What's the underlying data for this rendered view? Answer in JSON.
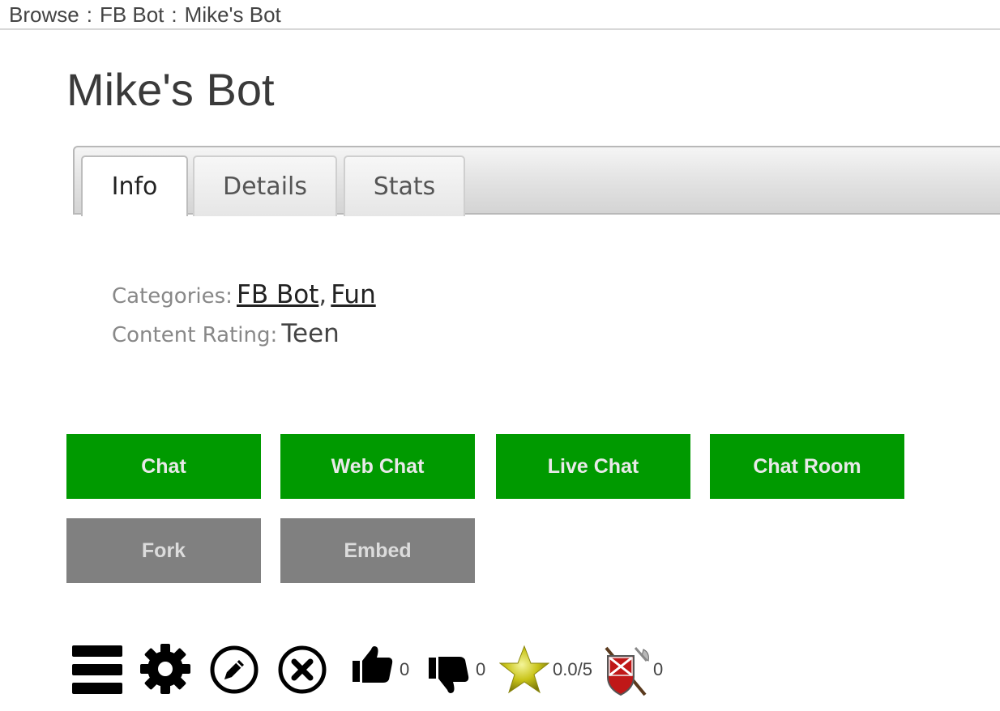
{
  "breadcrumb": {
    "items": [
      "Browse",
      "FB Bot",
      "Mike's Bot"
    ],
    "separator": ":"
  },
  "title": "Mike's Bot",
  "tabs": {
    "info": "Info",
    "details": "Details",
    "stats": "Stats",
    "active": "Info"
  },
  "info": {
    "categories_label": "Categories:",
    "categories": [
      "FB Bot",
      "Fun"
    ],
    "rating_label": "Content Rating:",
    "rating": "Teen"
  },
  "buttons": {
    "chat": "Chat",
    "web_chat": "Web Chat",
    "live_chat": "Live Chat",
    "chat_room": "Chat Room",
    "fork": "Fork",
    "embed": "Embed"
  },
  "toolbar": {
    "icons": [
      "menu-icon",
      "gear-icon",
      "edit-icon",
      "delete-icon",
      "thumbs-up-icon",
      "thumbs-down-icon",
      "star-icon",
      "flag-shield-icon"
    ],
    "thumbs_up_count": "0",
    "thumbs_down_count": "0",
    "star_rating": "0.0/5",
    "flag_count": "0"
  },
  "colors": {
    "primary_button": "#009a00",
    "secondary_button": "#808080"
  }
}
